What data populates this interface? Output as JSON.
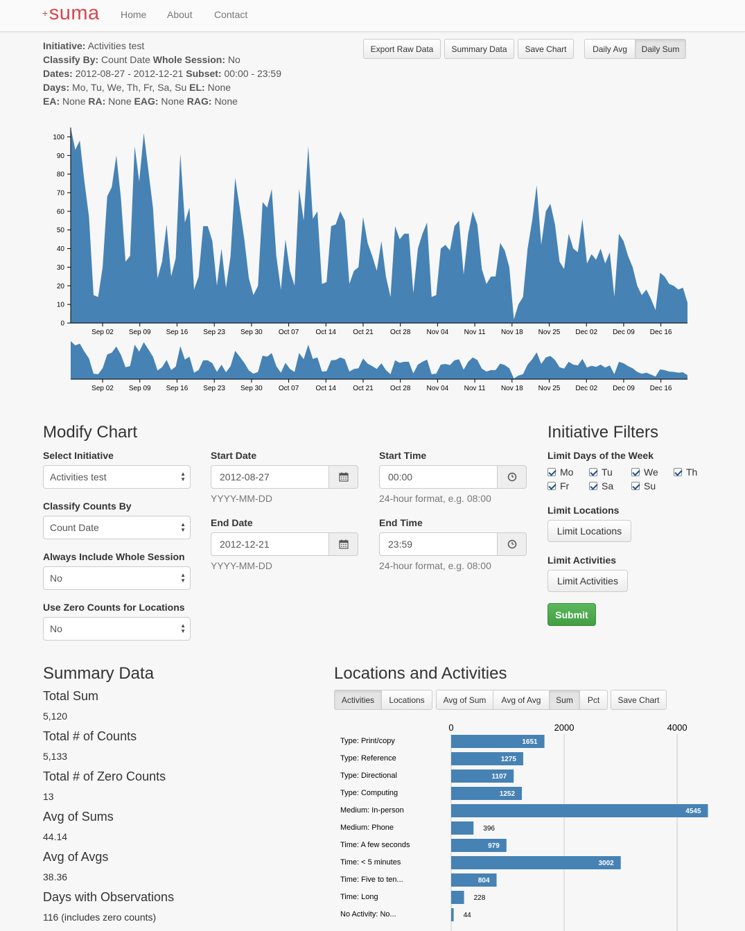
{
  "nav": {
    "brand_plus": "+",
    "brand": "suma",
    "links": [
      "Home",
      "About",
      "Contact"
    ]
  },
  "info": {
    "initiative_label": "Initiative:",
    "initiative": "Activities test",
    "classify_label": "Classify By:",
    "classify": "Count Date",
    "whole_session_label": "Whole Session:",
    "whole_session": "No",
    "dates_label": "Dates:",
    "dates": "2012-08-27 - 2012-12-21",
    "subset_label": "Subset:",
    "subset": "00:00 - 23:59",
    "days_label": "Days:",
    "days": "Mo, Tu, We, Th, Fr, Sa, Su",
    "el_label": "EL:",
    "el": "None",
    "ea_label": "EA:",
    "ea": "None",
    "ra_label": "RA:",
    "ra": "None",
    "eag_label": "EAG:",
    "eag": "None",
    "rag_label": "RAG:",
    "rag": "None"
  },
  "toolbar": {
    "export_raw": "Export Raw Data",
    "summary_data": "Summary Data",
    "save_chart": "Save Chart",
    "daily_avg": "Daily Avg",
    "daily_sum": "Daily Sum"
  },
  "chart_data": [
    {
      "type": "area",
      "title": "",
      "xlabel": "",
      "ylabel": "",
      "ylim": [
        0,
        105
      ],
      "yticks": [
        0,
        10,
        20,
        30,
        40,
        50,
        60,
        70,
        80,
        90,
        100
      ],
      "xticks": [
        "Sep 02",
        "Sep 09",
        "Sep 16",
        "Sep 23",
        "Sep 30",
        "Oct 07",
        "Oct 14",
        "Oct 21",
        "Oct 28",
        "Nov 04",
        "Nov 11",
        "Nov 18",
        "Nov 25",
        "Dec 02",
        "Dec 09",
        "Dec 16"
      ],
      "x_start": "2012-08-27",
      "x_end": "2012-12-21",
      "color": "#4682b4",
      "values": [
        105,
        93,
        98,
        76,
        57,
        15,
        14,
        30,
        68,
        73,
        90,
        67,
        33,
        36,
        95,
        76,
        102,
        82,
        62,
        24,
        33,
        53,
        25,
        35,
        91,
        54,
        62,
        18,
        25,
        52,
        52,
        44,
        20,
        40,
        19,
        36,
        78,
        62,
        45,
        24,
        15,
        20,
        65,
        62,
        72,
        36,
        18,
        45,
        28,
        20,
        72,
        55,
        95,
        56,
        60,
        21,
        22,
        52,
        53,
        60,
        55,
        21,
        28,
        30,
        57,
        43,
        36,
        28,
        44,
        25,
        14,
        52,
        45,
        48,
        48,
        16,
        40,
        48,
        54,
        14,
        15,
        40,
        42,
        39,
        52,
        55,
        26,
        48,
        60,
        53,
        29,
        21,
        25,
        25,
        43,
        39,
        30,
        2,
        10,
        14,
        40,
        55,
        74,
        42,
        60,
        64,
        53,
        33,
        29,
        48,
        40,
        38,
        56,
        32,
        37,
        34,
        40,
        32,
        38,
        14,
        48,
        44,
        36,
        30,
        20,
        15,
        18,
        13,
        7,
        27,
        25,
        21,
        20,
        18,
        19,
        11
      ]
    },
    {
      "type": "bar",
      "orientation": "horizontal",
      "title": "",
      "xlim": [
        0,
        4600
      ],
      "xticks": [
        0,
        2000,
        4000
      ],
      "color": "#4682b4",
      "categories": [
        "Type: Print/copy",
        "Type: Reference",
        "Type: Directional",
        "Type: Computing",
        "Medium: In-person",
        "Medium: Phone",
        "Time: A few seconds",
        "Time: < 5 minutes",
        "Time: Five to ten...",
        "Time: Long",
        "No Activity: No..."
      ],
      "values": [
        1651,
        1275,
        1107,
        1252,
        4545,
        396,
        979,
        3002,
        804,
        228,
        44
      ]
    }
  ],
  "modify": {
    "title": "Modify Chart",
    "select_initiative_label": "Select Initiative",
    "select_initiative_value": "Activities test",
    "classify_label": "Classify Counts By",
    "classify_value": "Count Date",
    "whole_session_label": "Always Include Whole Session",
    "whole_session_value": "No",
    "zero_counts_label": "Use Zero Counts for Locations",
    "zero_counts_value": "No",
    "start_date_label": "Start Date",
    "start_date": "2012-08-27",
    "date_help": "YYYY-MM-DD",
    "end_date_label": "End Date",
    "end_date": "2012-12-21",
    "start_time_label": "Start Time",
    "start_time": "00:00",
    "time_help": "24-hour format, e.g. 08:00",
    "end_time_label": "End Time",
    "end_time": "23:59"
  },
  "filters": {
    "title": "Initiative Filters",
    "days_label": "Limit Days of the Week",
    "days": [
      "Mo",
      "Tu",
      "We",
      "Th",
      "Fr",
      "Sa",
      "Su"
    ],
    "locations_label": "Limit Locations",
    "locations_button": "Limit Locations",
    "activities_label": "Limit Activities",
    "activities_button": "Limit Activities",
    "submit": "Submit"
  },
  "summary": {
    "title": "Summary Data",
    "items": [
      {
        "label": "Total Sum",
        "value": "5,120"
      },
      {
        "label": "Total # of Counts",
        "value": "5,133"
      },
      {
        "label": "Total # of Zero Counts",
        "value": "13"
      },
      {
        "label": "Avg of Sums",
        "value": "44.14"
      },
      {
        "label": "Avg of Avgs",
        "value": "38.36"
      },
      {
        "label": "Days with Observations",
        "value": "116 (includes zero counts)"
      }
    ]
  },
  "locact": {
    "title": "Locations and Activities",
    "tabs": {
      "activities": "Activities",
      "locations": "Locations",
      "avg_of_sum": "Avg of Sum",
      "avg_of_avg": "Avg of Avg",
      "sum": "Sum",
      "pct": "Pct",
      "save_chart": "Save Chart"
    }
  }
}
